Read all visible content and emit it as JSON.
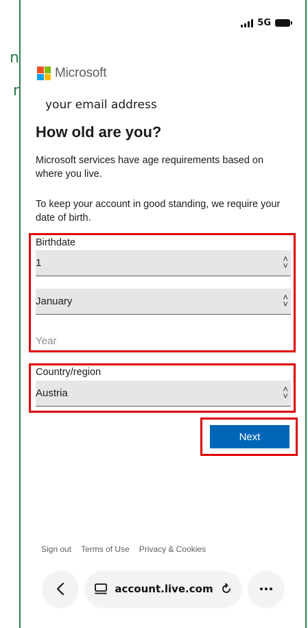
{
  "cut_text": [
    "n",
    "r"
  ],
  "status_bar": {
    "network": "5G",
    "icons": [
      "signal-icon",
      "battery-icon"
    ]
  },
  "brand": {
    "name": "Microsoft",
    "colors": [
      "#f25022",
      "#7fba00",
      "#00a4ef",
      "#ffb900"
    ]
  },
  "account": {
    "email_display": "your email address"
  },
  "page": {
    "title": "How old are you?",
    "description": "Microsoft services have age requirements based on where you live.",
    "requirement": "To keep your account in good standing, we require your date of birth."
  },
  "birthdate": {
    "label": "Birthdate",
    "day": "1",
    "month": "January",
    "year_placeholder": "Year"
  },
  "country": {
    "label": "Country/region",
    "value": "Austria"
  },
  "actions": {
    "next_label": "Next",
    "accent": "#0067b8"
  },
  "footer": {
    "sign_out": "Sign out",
    "terms": "Terms of Use",
    "privacy": "Privacy & Cookies"
  },
  "browser": {
    "url": "account.live.com",
    "icons": [
      "back-icon",
      "tabs-icon",
      "reload-icon",
      "more-icon"
    ]
  },
  "highlight_color": "#e00000"
}
